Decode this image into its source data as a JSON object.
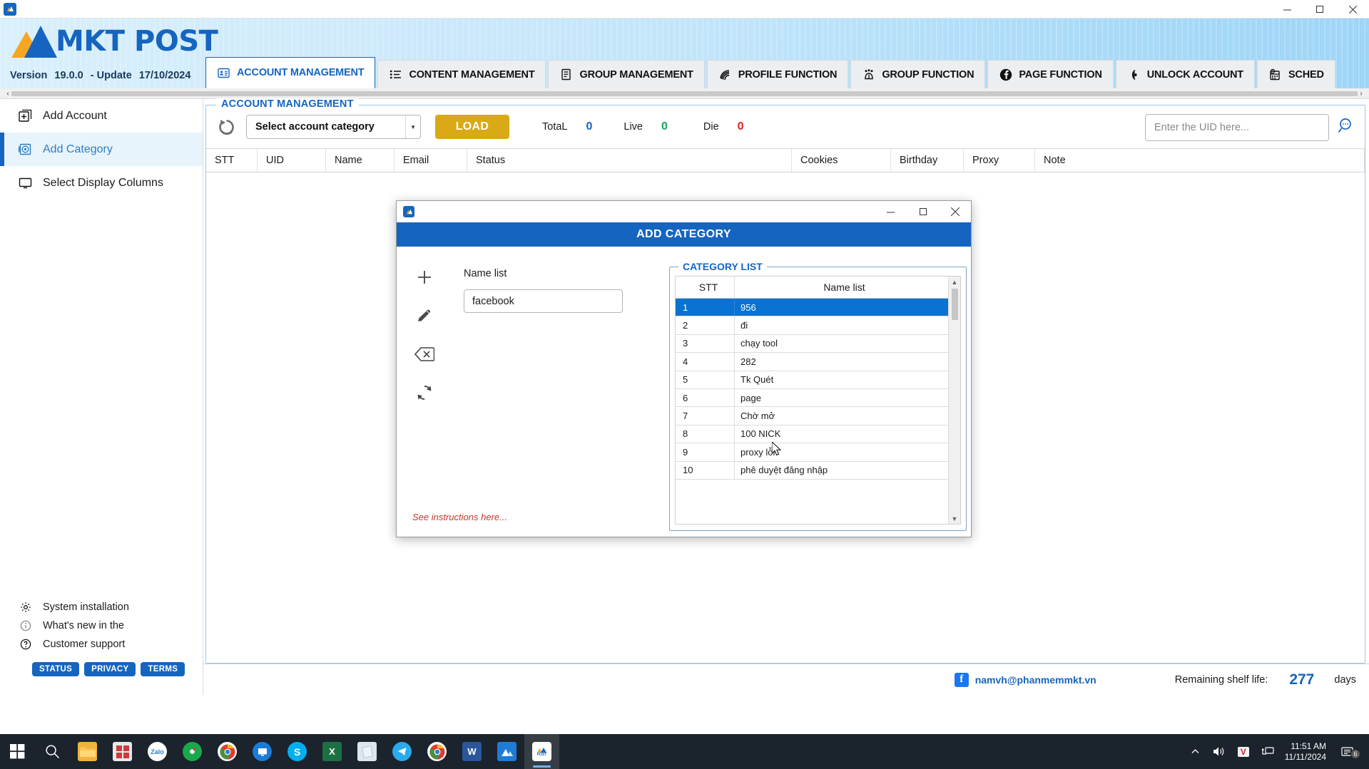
{
  "window": {
    "app_icon": "mkt-post-app-icon",
    "minimize": "–",
    "maximize": "▢",
    "close": "✕"
  },
  "header": {
    "brand": "MKT POST",
    "version_label": "Version",
    "version_value": "19.0.0",
    "update_label": "- Update",
    "update_value": "17/10/2024"
  },
  "tabs": [
    {
      "label": "ACCOUNT MANAGEMENT",
      "icon": "id-card-icon",
      "active": true
    },
    {
      "label": "CONTENT MANAGEMENT",
      "icon": "list-icon",
      "active": false
    },
    {
      "label": "GROUP MANAGEMENT",
      "icon": "document-icon",
      "active": false
    },
    {
      "label": "PROFILE FUNCTION",
      "icon": "fingerprint-icon",
      "active": false
    },
    {
      "label": "GROUP FUNCTION",
      "icon": "people-group-icon",
      "active": false
    },
    {
      "label": "PAGE FUNCTION",
      "icon": "facebook-icon",
      "active": false
    },
    {
      "label": "UNLOCK ACCOUNT",
      "icon": "unlock-signal-icon",
      "active": false
    },
    {
      "label": "SCHED",
      "icon": "calendar-clock-icon",
      "active": false
    }
  ],
  "sidebar": {
    "items": [
      {
        "label": "Add Account",
        "icon": "add-box-icon",
        "active": false
      },
      {
        "label": "Add Category",
        "icon": "category-icon",
        "active": true
      },
      {
        "label": "Select Display Columns",
        "icon": "monitor-icon",
        "active": false
      }
    ],
    "links": [
      {
        "label": "System installation",
        "icon": "gear-icon"
      },
      {
        "label": "What's new in the",
        "icon": "info-icon"
      },
      {
        "label": "Customer support",
        "icon": "question-icon"
      }
    ],
    "pills": [
      "STATUS",
      "PRIVACY",
      "TERMS"
    ]
  },
  "panel": {
    "title": "ACCOUNT MANAGEMENT",
    "refresh_icon": "refresh-icon",
    "category_select": "Select account category",
    "load_button": "LOAD",
    "counters": [
      {
        "label": "TotaL",
        "value": "0",
        "color": "#1565c0"
      },
      {
        "label": "Live",
        "value": "0",
        "color": "#18a558"
      },
      {
        "label": "Die",
        "value": "0",
        "color": "#e02020"
      }
    ],
    "search_placeholder": "Enter the UID here...",
    "search_icon": "search-icon",
    "grid_columns": [
      "STT",
      "UID",
      "Name",
      "Email",
      "Status",
      "Cookies",
      "Birthday",
      "Proxy",
      "Note"
    ]
  },
  "footer": {
    "facebook_icon": "facebook-icon",
    "email": "namvh@phanmemmkt.vn",
    "shelf_label": "Remaining shelf life:",
    "shelf_value": "277",
    "shelf_unit": "days"
  },
  "modal": {
    "title": "ADD CATEGORY",
    "app_icon": "mkt-post-app-icon",
    "minimize": "–",
    "maximize": "▢",
    "close": "✕",
    "tools": [
      {
        "name": "add-icon",
        "glyph": "+"
      },
      {
        "name": "edit-pencil-icon",
        "glyph": "✎"
      },
      {
        "name": "delete-backspace-icon",
        "glyph": "⌫"
      },
      {
        "name": "refresh-icon",
        "glyph": "⟳"
      }
    ],
    "name_list_label": "Name list",
    "name_list_value": "facebook",
    "instructions": "See instructions here...",
    "category_list_legend": "CATEGORY LIST",
    "table": {
      "columns": [
        "STT",
        "Name list"
      ],
      "rows": [
        {
          "stt": "1",
          "name": "956",
          "selected": true
        },
        {
          "stt": "2",
          "name": "đi",
          "selected": false
        },
        {
          "stt": "3",
          "name": "chạy tool",
          "selected": false
        },
        {
          "stt": "4",
          "name": "282",
          "selected": false
        },
        {
          "stt": "5",
          "name": "Tk Quét",
          "selected": false
        },
        {
          "stt": "6",
          "name": "page",
          "selected": false
        },
        {
          "stt": "7",
          "name": "Chờ mở",
          "selected": false
        },
        {
          "stt": "8",
          "name": "100 NICK",
          "selected": false
        },
        {
          "stt": "9",
          "name": "proxy lỗi",
          "selected": false
        },
        {
          "stt": "10",
          "name": "phê duyệt đăng nhập",
          "selected": false
        }
      ]
    }
  },
  "taskbar": {
    "start_icon": "windows-start-icon",
    "search_icon": "search-icon",
    "apps": [
      {
        "name": "file-explorer-icon",
        "color": "#f2b33d",
        "glyph": ""
      },
      {
        "name": "calculator-icon",
        "color": "#d8d8d8",
        "glyph": ""
      },
      {
        "name": "zalo-icon",
        "color": "#ffffff",
        "glyph": "Zalo"
      },
      {
        "name": "browser-green-icon",
        "color": "#1aa84a",
        "glyph": ""
      },
      {
        "name": "chrome-icon",
        "color": "#ffffff",
        "glyph": ""
      },
      {
        "name": "teamviewer-icon",
        "color": "#1a7cd9",
        "glyph": ""
      },
      {
        "name": "skype-icon",
        "color": "#00aff0",
        "glyph": "S"
      },
      {
        "name": "excel-icon",
        "color": "#1d7044",
        "glyph": "X"
      },
      {
        "name": "notes-icon",
        "color": "#dce6ef",
        "glyph": ""
      },
      {
        "name": "telegram-icon",
        "color": "#2aabee",
        "glyph": ""
      },
      {
        "name": "chrome-profile-icon",
        "color": "#ffffff",
        "glyph": ""
      },
      {
        "name": "word-icon",
        "color": "#2b579a",
        "glyph": "W"
      },
      {
        "name": "photos-icon",
        "color": "#1e7bd6",
        "glyph": ""
      },
      {
        "name": "mkt-post-icon",
        "color": "#ffffff",
        "glyph": "POST"
      }
    ],
    "tray": {
      "chevron": "︿",
      "volume_icon": "volume-icon",
      "v_icon": "V",
      "network_icon": "network-icon",
      "time": "11:51 AM",
      "date": "11/11/2024",
      "notification_icon": "notification-icon",
      "notification_count": "6"
    }
  }
}
